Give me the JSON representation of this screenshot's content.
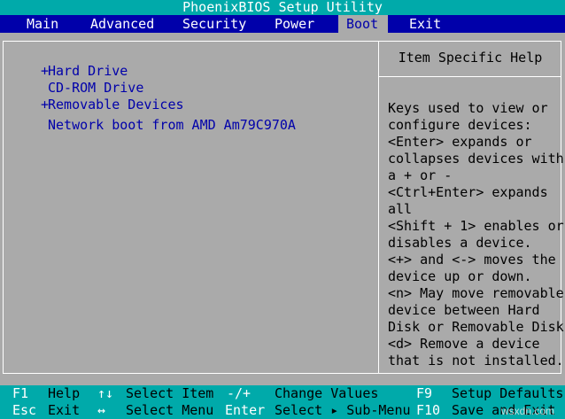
{
  "title": "PhoenixBIOS Setup Utility",
  "menu": {
    "items": [
      {
        "label": "Main",
        "active": false
      },
      {
        "label": "Advanced",
        "active": false
      },
      {
        "label": "Security",
        "active": false
      },
      {
        "label": "Power",
        "active": false
      },
      {
        "label": "Boot",
        "active": true
      },
      {
        "label": "Exit",
        "active": false
      }
    ]
  },
  "boot_order": [
    {
      "prefix": "+",
      "label": "Hard Drive"
    },
    {
      "prefix": "",
      "label": "CD-ROM Drive"
    },
    {
      "prefix": "+",
      "label": "Removable Devices"
    },
    {
      "prefix": "",
      "label": "Network boot from AMD Am79C970A"
    }
  ],
  "help": {
    "title": "Item Specific Help",
    "lines": [
      "Keys used to view or",
      "configure devices:",
      "<Enter> expands or",
      "collapses devices with",
      "a + or -",
      "<Ctrl+Enter> expands",
      "all",
      "<Shift + 1> enables or",
      "disables a device.",
      "<+> and <-> moves the",
      "device up or down.",
      "<n> May move removable",
      "device between Hard",
      "Disk or Removable Disk",
      "<d> Remove a device",
      "that is not installed."
    ]
  },
  "keybar": {
    "row1": {
      "k1": "F1",
      "d1": "Help",
      "k2": "↑↓",
      "d2": "Select Item",
      "k3": "-/+",
      "d3": "Change Values",
      "k4": "F9",
      "d4": "Setup Defaults"
    },
    "row2": {
      "k1": "Esc",
      "d1": "Exit",
      "k2": "↔",
      "d2": "Select Menu",
      "k3": "Enter",
      "d3": "Select ▸ Sub-Menu",
      "k4": "F10",
      "d4": "Save and Exit"
    }
  },
  "watermark": "wsxdn.com",
  "colors": {
    "background": "#aaaaaa",
    "titlebar": "#00aaaa",
    "menubar": "#0000aa",
    "selected_text": "#0000aa",
    "key_text": "#ffffff"
  }
}
